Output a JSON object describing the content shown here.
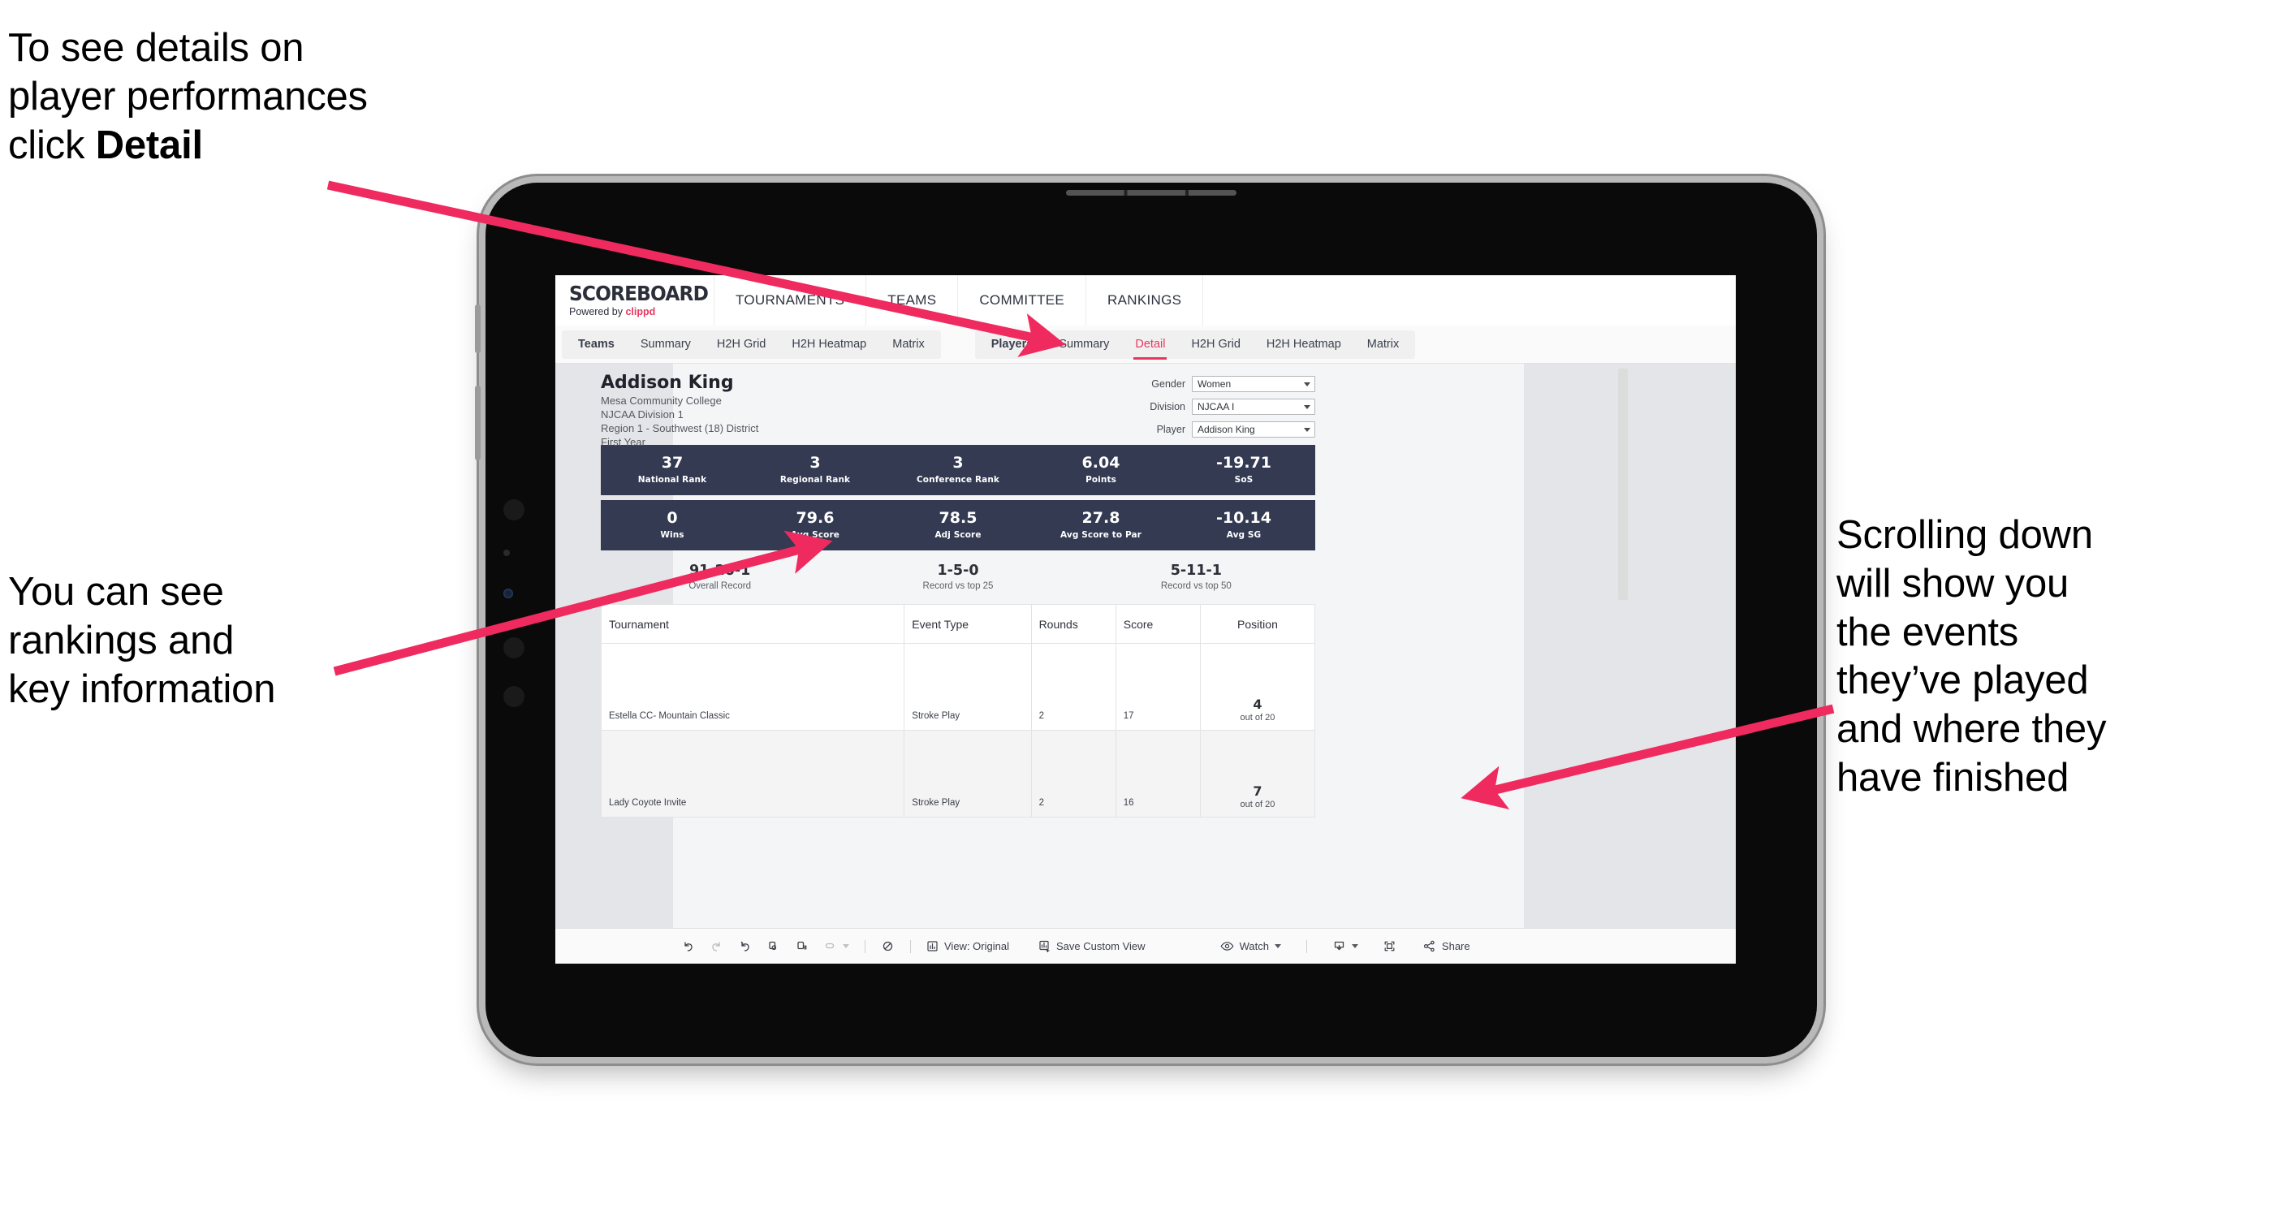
{
  "annotations": {
    "detail": "To see details on\nplayer performances\nclick ",
    "detail_bold": "Detail",
    "rankings": "You can see\nrankings and\nkey information",
    "scrolling": "Scrolling down\nwill show you\nthe events\nthey’ve played\nand where they\nhave finished",
    "arrow_color": "#ef2a5f"
  },
  "app": {
    "brand": {
      "title": "SCOREBOARD",
      "powered_prefix": "Powered by ",
      "powered_name": "clippd"
    },
    "top_nav": [
      "TOURNAMENTS",
      "TEAMS",
      "COMMITTEE",
      "RANKINGS"
    ],
    "tab_groups": [
      {
        "name": "teams",
        "tabs": [
          {
            "label": "Teams",
            "strong": true,
            "active": false
          },
          {
            "label": "Summary",
            "strong": false,
            "active": false
          },
          {
            "label": "H2H Grid",
            "strong": false,
            "active": false
          },
          {
            "label": "H2H Heatmap",
            "strong": false,
            "active": false
          },
          {
            "label": "Matrix",
            "strong": false,
            "active": false
          }
        ]
      },
      {
        "name": "players",
        "tabs": [
          {
            "label": "Players",
            "strong": true,
            "active": false
          },
          {
            "label": "Summary",
            "strong": false,
            "active": false
          },
          {
            "label": "Detail",
            "strong": false,
            "active": true
          },
          {
            "label": "H2H Grid",
            "strong": false,
            "active": false
          },
          {
            "label": "H2H Heatmap",
            "strong": false,
            "active": false
          },
          {
            "label": "Matrix",
            "strong": false,
            "active": false
          }
        ]
      }
    ]
  },
  "player": {
    "name": "Addison King",
    "school": "Mesa Community College",
    "division": "NJCAA Division 1",
    "region": "Region 1 - Southwest (18) District",
    "year": "First Year"
  },
  "filters": [
    {
      "label": "Gender",
      "value": "Women"
    },
    {
      "label": "Division",
      "value": "NJCAA I"
    },
    {
      "label": "Player",
      "value": "Addison King"
    }
  ],
  "stats_row1": [
    {
      "value": "37",
      "label": "National Rank"
    },
    {
      "value": "3",
      "label": "Regional Rank"
    },
    {
      "value": "3",
      "label": "Conference Rank"
    },
    {
      "value": "6.04",
      "label": "Points"
    },
    {
      "value": "-19.71",
      "label": "SoS"
    }
  ],
  "stats_row2": [
    {
      "value": "0",
      "label": "Wins"
    },
    {
      "value": "79.6",
      "label": "Avg Score"
    },
    {
      "value": "78.5",
      "label": "Adj Score"
    },
    {
      "value": "27.8",
      "label": "Avg Score to Par"
    },
    {
      "value": "-10.14",
      "label": "Avg SG"
    }
  ],
  "records": [
    {
      "value": "91-20-1",
      "label": "Overall Record"
    },
    {
      "value": "1-5-0",
      "label": "Record vs top 25"
    },
    {
      "value": "5-11-1",
      "label": "Record vs top 50"
    }
  ],
  "events_table": {
    "headers": [
      "Tournament",
      "Event Type",
      "Rounds",
      "Score",
      "Position"
    ],
    "rows": [
      {
        "tournament": "Estella CC- Mountain Classic",
        "event_type": "Stroke Play",
        "rounds": "2",
        "score": "17",
        "position": "4",
        "position_sub": "out of 20"
      },
      {
        "tournament": "Lady Coyote Invite",
        "event_type": "Stroke Play",
        "rounds": "2",
        "score": "16",
        "position": "7",
        "position_sub": "out of 20"
      }
    ]
  },
  "toolbar": {
    "view_label": "View: Original",
    "save_label": "Save Custom View",
    "watch_label": "Watch",
    "share_label": "Share"
  }
}
